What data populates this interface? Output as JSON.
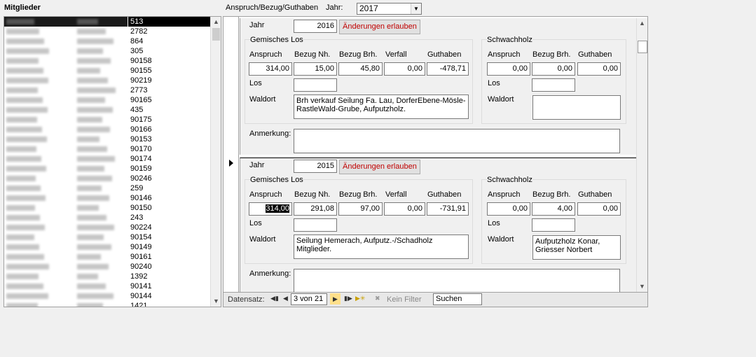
{
  "header": {
    "members_label": "Mitglieder",
    "form_title": "Anspruch/Bezug/Guthaben",
    "year_label": "Jahr:",
    "year_value": "2017"
  },
  "members": {
    "numbers": [
      "513",
      "2782",
      "864",
      "305",
      "90158",
      "90155",
      "90219",
      "2773",
      "90165",
      "435",
      "90175",
      "90166",
      "90153",
      "90170",
      "90174",
      "90159",
      "90246",
      "259",
      "90146",
      "90150",
      "243",
      "90224",
      "90154",
      "90149",
      "90161",
      "90240",
      "1392",
      "90141",
      "90144",
      "1421"
    ]
  },
  "records": [
    {
      "jahr_label": "Jahr",
      "jahr": "2016",
      "change_button": "Änderungen erlauben",
      "gemisches_title": "Gemisches Los",
      "anspruch_label": "Anspruch",
      "bezug_nh_label": "Bezug Nh.",
      "bezug_brh_label": "Bezug Brh.",
      "verfall_label": "Verfall",
      "guthaben_label": "Guthaben",
      "anspruch": "314,00",
      "bezug_nh": "15,00",
      "bezug_brh": "45,80",
      "verfall": "0,00",
      "guthaben": "-478,71",
      "los_label": "Los",
      "waldort_label": "Waldort",
      "waldort": "Brh verkauf Seilung Fa. Lau, DorferEbene-Mösle-RastleWald-Grube, Aufputzholz.",
      "schwach_title": "Schwachholz",
      "s_anspruch_label": "Anspruch",
      "s_bezug_brh_label": "Bezug Brh.",
      "s_guthaben_label": "Guthaben",
      "s_anspruch": "0,00",
      "s_bezug_brh": "0,00",
      "s_guthaben": "0,00",
      "s_los_label": "Los",
      "s_waldort_label": "Waldort",
      "s_waldort": "",
      "anmerkung_label": "Anmerkung:"
    },
    {
      "jahr_label": "Jahr",
      "jahr": "2015",
      "change_button": "Änderungen erlauben",
      "gemisches_title": "Gemisches Los",
      "anspruch_label": "Anspruch",
      "bezug_nh_label": "Bezug Nh.",
      "bezug_brh_label": "Bezug Brh.",
      "verfall_label": "Verfall",
      "guthaben_label": "Guthaben",
      "anspruch": "314,00",
      "bezug_nh": "291,08",
      "bezug_brh": "97,00",
      "verfall": "0,00",
      "guthaben": "-731,91",
      "los_label": "Los",
      "waldort_label": "Waldort",
      "waldort": "Seilung Hemerach, Aufputz.-/Schadholz Mitglieder.",
      "schwach_title": "Schwachholz",
      "s_anspruch_label": "Anspruch",
      "s_bezug_brh_label": "Bezug Brh.",
      "s_guthaben_label": "Guthaben",
      "s_anspruch": "0,00",
      "s_bezug_brh": "4,00",
      "s_guthaben": "0,00",
      "s_los_label": "Los",
      "s_waldort_label": "Waldort",
      "s_waldort": "Aufputzholz Konar, Griesser Norbert",
      "anmerkung_label": "Anmerkung:"
    }
  ],
  "navigation": {
    "label": "Datensatz:",
    "position": "3 von 21",
    "filter": "Kein Filter",
    "search": "Suchen"
  }
}
